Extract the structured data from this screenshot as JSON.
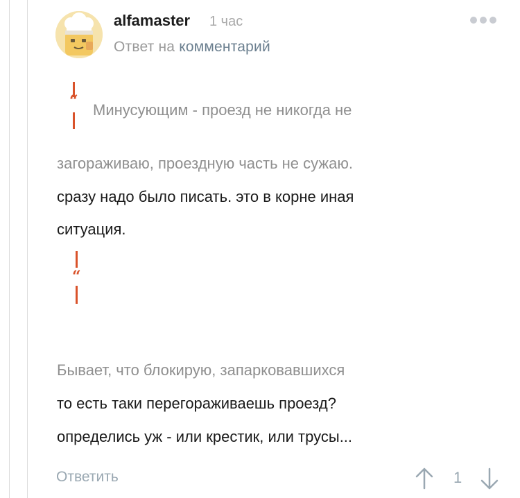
{
  "comment": {
    "author": "alfamaster",
    "time": "1 час",
    "reply_prefix": "Ответ на",
    "reply_link": "комментарий"
  },
  "content": {
    "quote1_line1": "Минусующим - проезд не никогда не",
    "quote1_line2": "загораживаю, проездную часть не сужаю.",
    "reply1_line1": "сразу надо было писать. это в корне иная",
    "reply1_line2": "ситуация.",
    "quote2_line1": "Бывает, что блокирую, запарковавшихся",
    "reply2_line1": "то есть таки перегораживаешь проезд?",
    "reply2_line2": "определись уж - или крестик, или трусы..."
  },
  "actions": {
    "reply_label": "Ответить",
    "vote_count": "1"
  },
  "icons": [
    "avatar-chef-icon",
    "more-dots-icon",
    "quote-mark-icon",
    "arrow-up-icon",
    "arrow-down-icon"
  ],
  "colors": {
    "quote_accent": "#d9532b",
    "link": "#6b7f8f",
    "muted": "#9aa8b2"
  }
}
